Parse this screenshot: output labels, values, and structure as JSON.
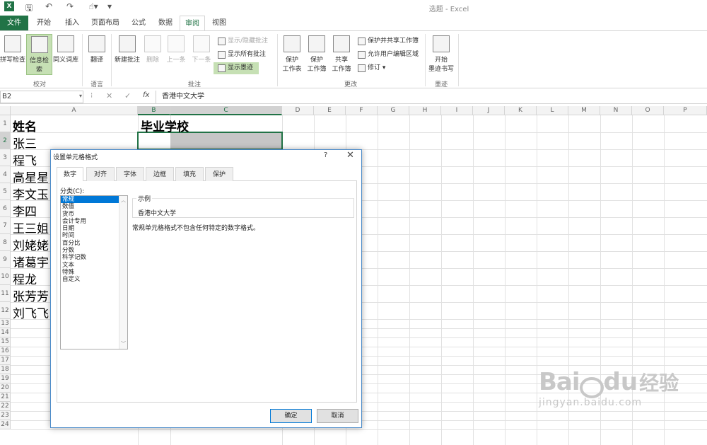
{
  "window": {
    "title": "选题 - Excel"
  },
  "ribbon_tabs": [
    "文件",
    "开始",
    "插入",
    "页面布局",
    "公式",
    "数据",
    "审阅",
    "视图"
  ],
  "ribbon": {
    "proofing": {
      "spell": "拼写检查",
      "research": "信息检索",
      "thesaurus": "同义词库",
      "label": "校对"
    },
    "language": {
      "translate": "翻译",
      "label": "语言"
    },
    "comments": {
      "new": "新建批注",
      "delete": "删除",
      "prev": "上一条",
      "next": "下一条",
      "showhide": "显示/隐藏批注",
      "showall": "显示所有批注",
      "ink": "显示墨迹",
      "label": "批注"
    },
    "changes": {
      "protect_sheet_l1": "保护",
      "protect_sheet_l2": "工作表",
      "protect_book_l1": "保护",
      "protect_book_l2": "工作簿",
      "share_l1": "共享",
      "share_l2": "工作簿",
      "protect_share": "保护并共享工作簿",
      "allow_edit": "允许用户编辑区域",
      "track": "修订 ▾",
      "label": "更改"
    },
    "ink": {
      "start_l1": "开始",
      "start_l2": "墨迹书写",
      "label": "墨迹"
    }
  },
  "formula_bar": {
    "cell": "B2",
    "fx": "fx",
    "value": "香港中文大学"
  },
  "columns": [
    "A",
    "B",
    "C",
    "D",
    "E",
    "F",
    "G",
    "H",
    "I",
    "J",
    "K",
    "L",
    "M",
    "N",
    "O",
    "P"
  ],
  "rows": [
    "1",
    "2",
    "3",
    "4",
    "5",
    "6",
    "7",
    "8",
    "9",
    "10",
    "11",
    "12",
    "13",
    "14",
    "15",
    "16",
    "17",
    "18",
    "19",
    "20",
    "21",
    "22",
    "23",
    "24"
  ],
  "cells": {
    "a1": "姓名",
    "b1": "毕业学校",
    "a2": "张三",
    "a3": "程飞",
    "a4": "高星星",
    "a5": "李文玉",
    "a6": "李四",
    "a7": "王三姐",
    "a8": "刘姥姥",
    "a9": "诸葛宇",
    "a10": "程龙",
    "a11": "张芳芳",
    "a12": "刘飞飞"
  },
  "dialog": {
    "title": "设置单元格格式",
    "help": "?",
    "close": "✕",
    "tabs": [
      "数字",
      "对齐",
      "字体",
      "边框",
      "填充",
      "保护"
    ],
    "category_label": "分类(C):",
    "categories": [
      "常规",
      "数值",
      "货币",
      "会计专用",
      "日期",
      "时间",
      "百分比",
      "分数",
      "科学记数",
      "文本",
      "特殊",
      "自定义"
    ],
    "sample_label": "示例",
    "sample_value": "香港中文大学",
    "description": "常规单元格格式不包含任何特定的数字格式。",
    "ok": "确定",
    "cancel": "取消"
  },
  "watermark": {
    "brand": "Bai",
    "brand2": "du",
    "cn": "经验",
    "url": "jingyan.baidu.com"
  }
}
